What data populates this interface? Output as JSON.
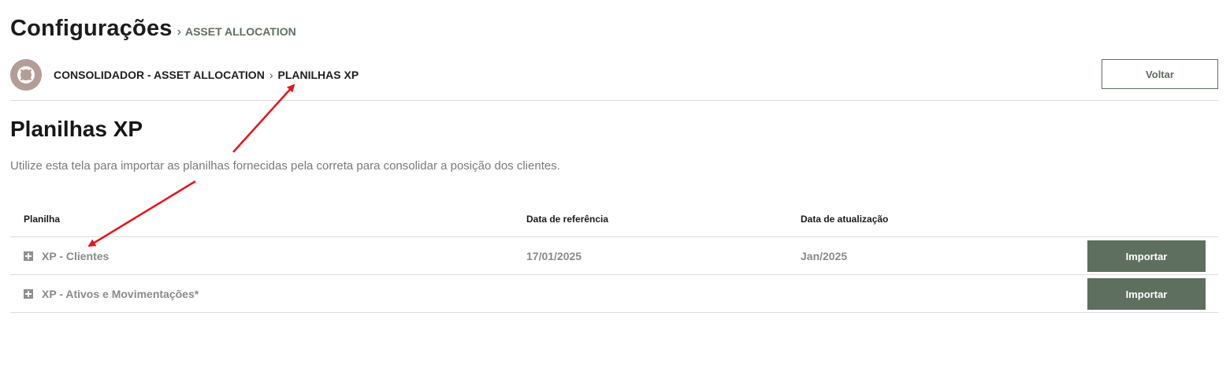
{
  "header": {
    "title": "Configurações",
    "separator": "›",
    "crumb": "ASSET ALLOCATION"
  },
  "toolbar": {
    "breadcrumb": [
      "CONSOLIDADOR - ASSET ALLOCATION",
      "PLANILHAS XP"
    ],
    "breadcrumb_separator": "›",
    "back_label": "Voltar"
  },
  "section": {
    "title": "Planilhas XP",
    "description": "Utilize esta tela para importar as planilhas fornecidas pela correta para consolidar a posição dos clientes."
  },
  "table": {
    "columns": [
      "Planilha",
      "Data de referência",
      "Data de atualização"
    ],
    "rows": [
      {
        "name": "XP - Clientes",
        "reference_date": "17/01/2025",
        "update_date": "Jan/2025",
        "action": "Importar"
      },
      {
        "name": "XP - Ativos e Movimentações*",
        "reference_date": "",
        "update_date": "",
        "action": "Importar"
      }
    ]
  },
  "colors": {
    "accent": "#5e6e5f",
    "avatar": "#b49c97",
    "annotation_arrow": "#e8141c"
  }
}
